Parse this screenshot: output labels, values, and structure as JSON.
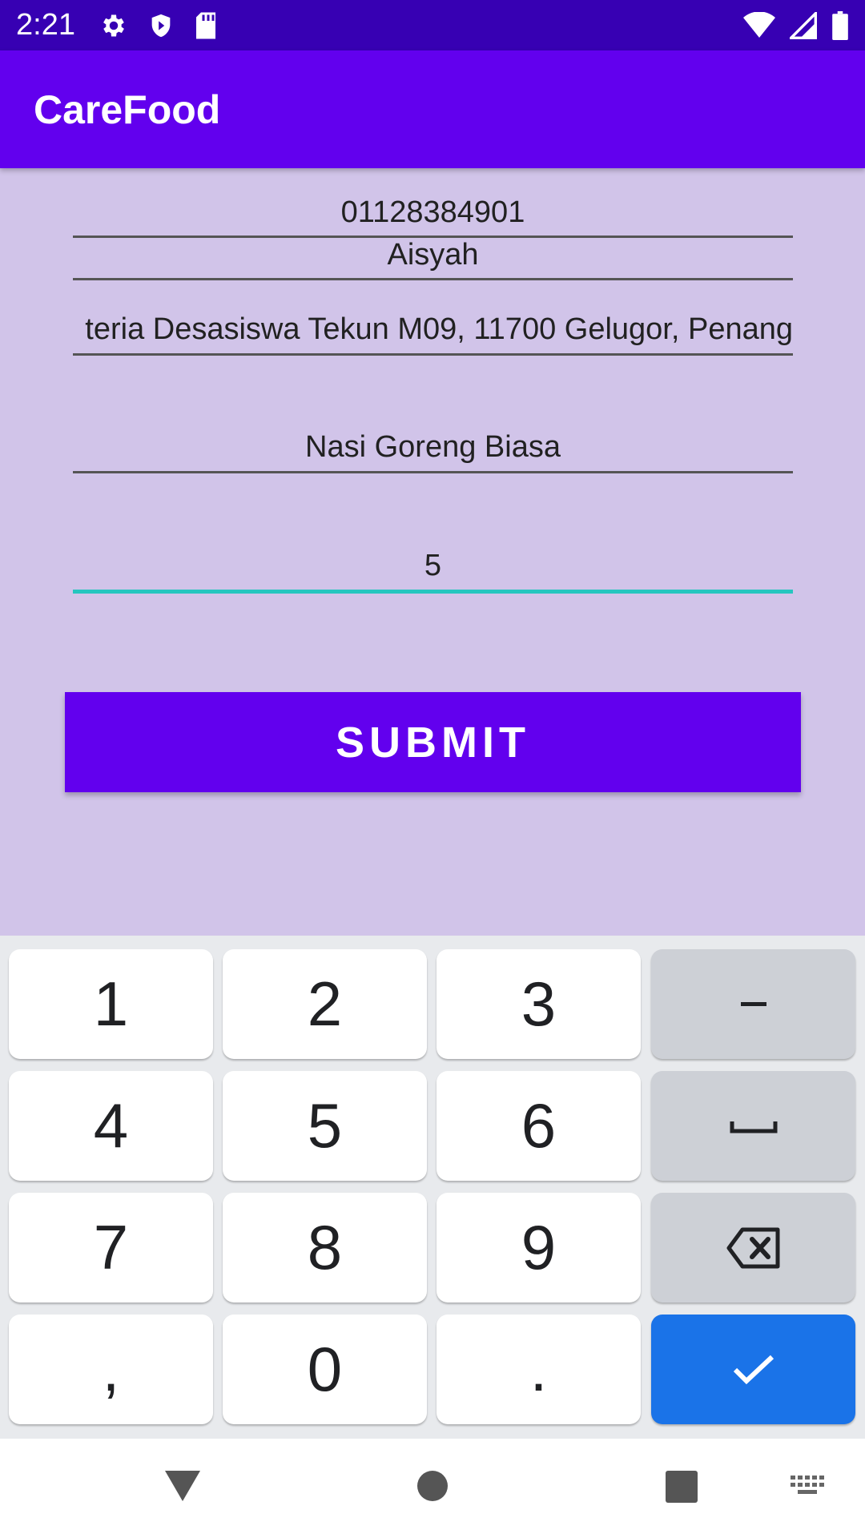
{
  "status_bar": {
    "time": "2:21",
    "icons": [
      "gear-icon",
      "shield-icon",
      "sd-card-icon",
      "wifi-icon",
      "signal-icon",
      "battery-icon"
    ]
  },
  "app_bar": {
    "title": "CareFood"
  },
  "form": {
    "phone_value": "01128384901",
    "name_value": "Aisyah",
    "address_value": "teria Desasiswa Tekun M09, 11700 Gelugor, Penang",
    "food_value": "Nasi Goreng Biasa",
    "quantity_value": "5",
    "submit_label": "SUBMIT"
  },
  "keyboard": {
    "keys": [
      "1",
      "2",
      "3",
      "–",
      "4",
      "5",
      "6",
      "␣",
      "7",
      "8",
      "9",
      "⌫",
      ",",
      "0",
      ".",
      "✓"
    ]
  },
  "colors": {
    "status_bar": "#3700b3",
    "app_bar": "#6200ee",
    "background": "#d1c4e9",
    "focus_underline": "#26c6bf",
    "enter_key": "#1a73e8"
  }
}
